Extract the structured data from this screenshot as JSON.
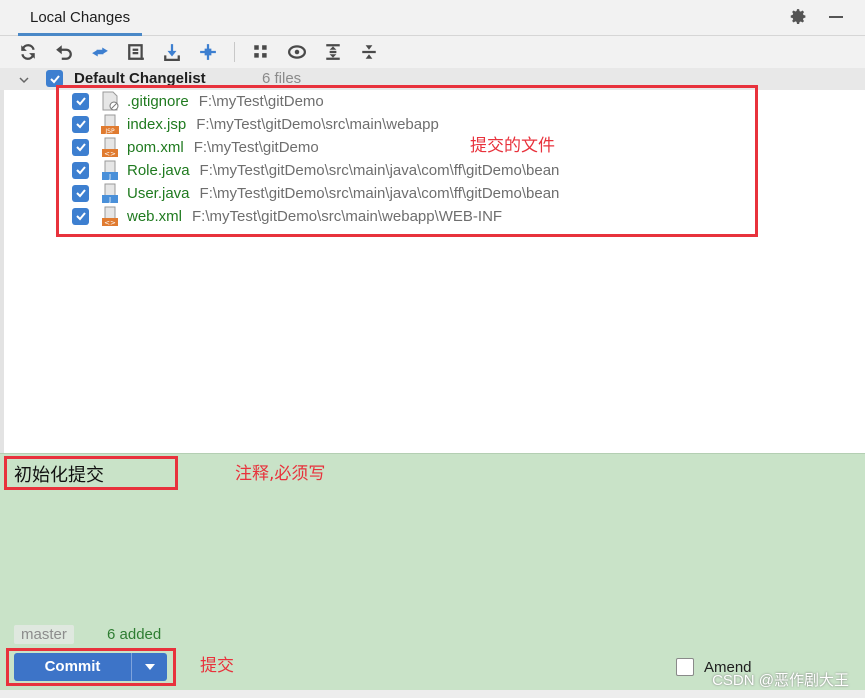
{
  "tab": {
    "title": "Local Changes"
  },
  "toolbar": {
    "icons": [
      "refresh-icon",
      "rollback-icon",
      "diff-icon",
      "shelve-icon",
      "update-icon",
      "move-icon",
      "group-icon",
      "show-icon",
      "expand-icon",
      "collapse-icon"
    ]
  },
  "changelist": {
    "name": "Default Changelist",
    "count": "6 files",
    "files": [
      {
        "name": ".gitignore",
        "path": "F:\\myTest\\gitDemo",
        "icon": "gitignore-file-icon"
      },
      {
        "name": "index.jsp",
        "path": "F:\\myTest\\gitDemo\\src\\main\\webapp",
        "icon": "jsp-file-icon"
      },
      {
        "name": "pom.xml",
        "path": "F:\\myTest\\gitDemo",
        "icon": "xml-file-icon"
      },
      {
        "name": "Role.java",
        "path": "F:\\myTest\\gitDemo\\src\\main\\java\\com\\ff\\gitDemo\\bean",
        "icon": "java-file-icon"
      },
      {
        "name": "User.java",
        "path": "F:\\myTest\\gitDemo\\src\\main\\java\\com\\ff\\gitDemo\\bean",
        "icon": "java-file-icon"
      },
      {
        "name": "web.xml",
        "path": "F:\\myTest\\gitDemo\\src\\main\\webapp\\WEB-INF",
        "icon": "xml-file-icon"
      }
    ]
  },
  "annotations": {
    "files": "提交的文件",
    "message": "注释,必须写",
    "commit": "提交"
  },
  "commit": {
    "message": "初始化提交",
    "branch": "master",
    "added": "6 added",
    "button_label": "Commit",
    "amend_label": "Amend"
  },
  "watermark": "CSDN @恶作剧大王",
  "colors": {
    "accent": "#3d74c8",
    "annotation": "#e8323c",
    "message_bg": "#c9e3c8",
    "file_name": "#1f7a1f"
  }
}
